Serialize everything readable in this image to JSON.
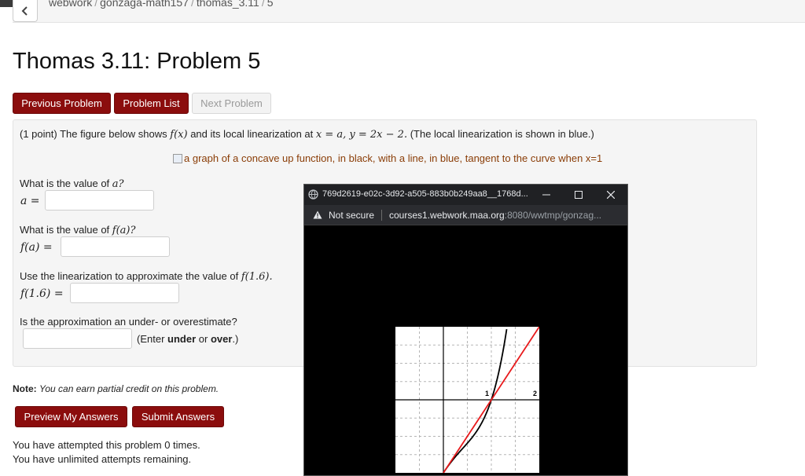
{
  "breadcrumb": [
    "webwork",
    "gonzaga-math157",
    "thomas_3.11",
    "5"
  ],
  "page_title": "Thomas 3.11: Problem 5",
  "nav": {
    "previous_label": "Previous Problem",
    "list_label": "Problem List",
    "next_label": "Next Problem"
  },
  "problem": {
    "points": "(1 point) The figure below shows",
    "f_of_x": "f(x)",
    "mid_text": "and its local linearization at",
    "condition": "x = a, y = 2x − 2.",
    "tail_text": "(The local linearization is shown in blue.)",
    "image_alt": "a graph of a concave up function, in black, with a line, in blue, tangent to the curve when x=1",
    "q1_text": "What is the value of",
    "q1_var": "a?",
    "q1_label": "a =",
    "q2_text": "What is the value of",
    "q2_var": "f(a)?",
    "q2_label": "f(a) =",
    "q3_text": "Use the linearization to approximate the value of",
    "q3_var": "f(1.6).",
    "q3_label": "f(1.6) =",
    "q4_text": "Is the approximation an under- or overestimate?",
    "q4_hint_pre": "(Enter",
    "q4_under": "under",
    "q4_or": "or",
    "q4_over": "over",
    "q4_hint_post": ".)"
  },
  "note": {
    "label": "Note:",
    "text": "You can earn partial credit on this problem."
  },
  "actions": {
    "preview_label": "Preview My Answers",
    "submit_label": "Submit Answers"
  },
  "status": {
    "attempts": "You have attempted this problem 0 times.",
    "remaining": "You have unlimited attempts remaining."
  },
  "popup": {
    "window_title": "769d2619-e02c-3d92-a505-883b0b249aa8__1768d...",
    "not_secure": "Not secure",
    "url_host": "courses1.webwork.maa.org",
    "url_rest": ":8080/wwtmp/gonzag...",
    "graph": {
      "x_range": [
        -1,
        2
      ],
      "y_range": [
        -2,
        2
      ],
      "tick_labels": [
        "1",
        "2"
      ],
      "curve_color": "#000000",
      "line_color": "#e8191b"
    }
  },
  "colors": {
    "brand_red": "#8b0d0d",
    "image_alt_text": "#8a3d07"
  }
}
